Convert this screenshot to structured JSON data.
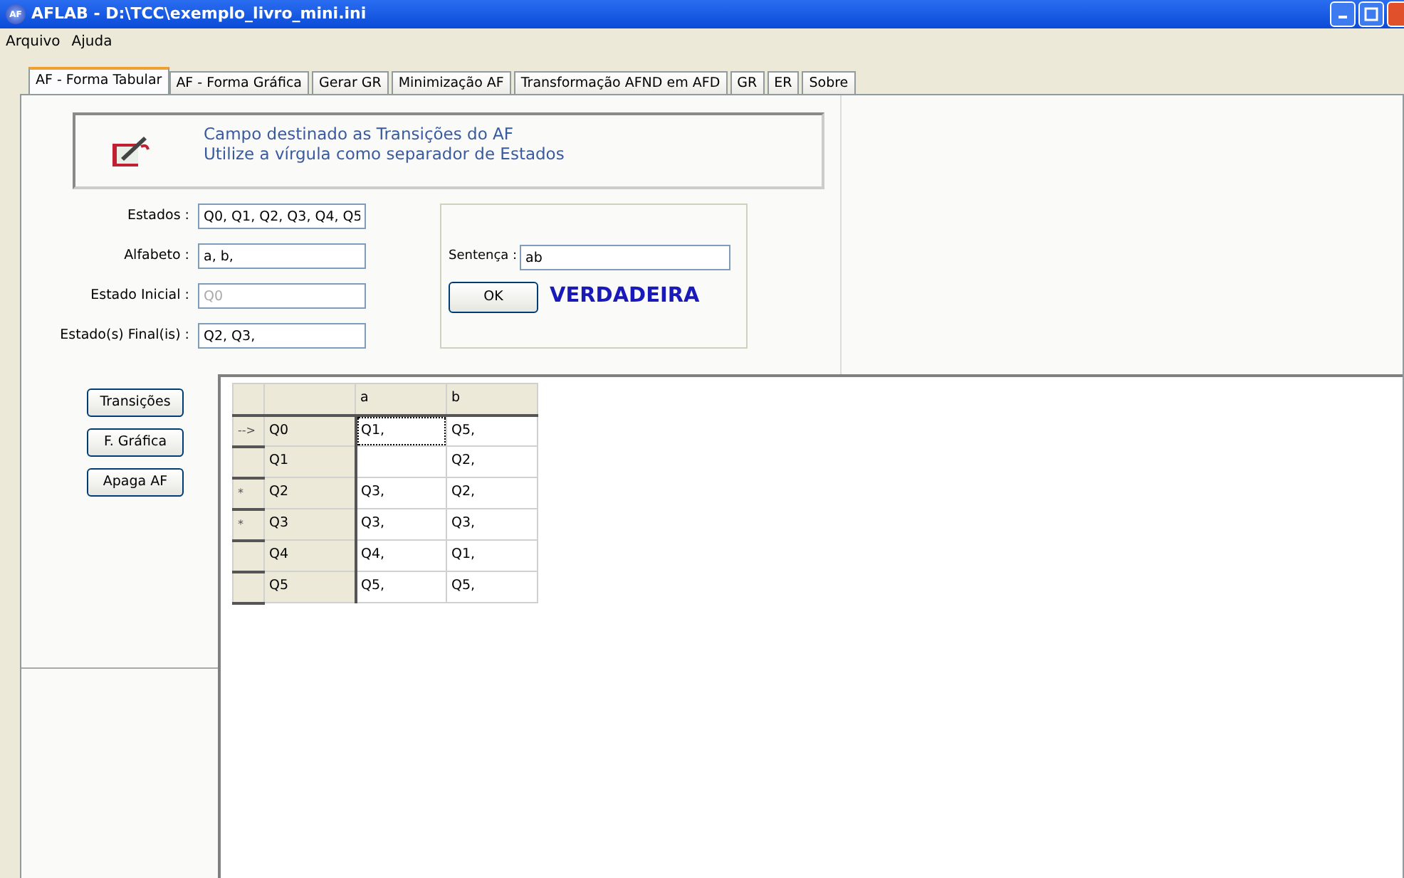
{
  "window": {
    "icon_label": "AF",
    "title": "AFLAB - D:\\TCC\\exemplo_livro_mini.ini"
  },
  "menu": [
    "Arquivo",
    "Ajuda"
  ],
  "tabs": [
    {
      "label": "AF - Forma Tabular",
      "selected": true
    },
    {
      "label": "AF - Forma Gráfica",
      "selected": false
    },
    {
      "label": "Gerar GR",
      "selected": false
    },
    {
      "label": "Minimização AF",
      "selected": false
    },
    {
      "label": "Transformação AFND em AFD",
      "selected": false
    },
    {
      "label": "GR",
      "selected": false
    },
    {
      "label": "ER",
      "selected": false
    },
    {
      "label": "Sobre",
      "selected": false
    }
  ],
  "info": [
    "Campo destinado as Transições do AF",
    "Utilize a vírgula como separador de Estados"
  ],
  "fields": [
    {
      "label": "Estados :",
      "value": "Q0, Q1, Q2, Q3, Q4, Q5",
      "disabled": false
    },
    {
      "label": "Alfabeto :",
      "value": "a, b,",
      "disabled": false
    },
    {
      "label": "Estado Inicial :",
      "value": "Q0",
      "disabled": true
    },
    {
      "label": "Estado(s) Final(is) :",
      "value": "Q2, Q3,",
      "disabled": false
    }
  ],
  "test": {
    "label": "Sentença :",
    "value": "ab",
    "button": "OK",
    "result": "VERDADEIRA"
  },
  "buttons": [
    "Transições",
    "F. Gráfica",
    "Apaga AF"
  ],
  "table": {
    "columns": [
      "a",
      "b"
    ],
    "rows": [
      {
        "marker": "-->",
        "state": "Q0",
        "cells": [
          {
            "text": "Q1,",
            "focused": true
          },
          {
            "text": "Q5,",
            "focused": false
          }
        ]
      },
      {
        "state": "Q1",
        "cells": [
          {
            "focused": false
          },
          {
            "text": "Q2,",
            "focused": false
          }
        ]
      },
      {
        "marker": "*",
        "state": "Q2",
        "cells": [
          {
            "text": "Q3,",
            "focused": false
          },
          {
            "text": "Q2,",
            "focused": false
          }
        ]
      },
      {
        "marker": "*",
        "state": "Q3",
        "cells": [
          {
            "text": "Q3,",
            "focused": false
          },
          {
            "text": "Q3,",
            "focused": false
          }
        ]
      },
      {
        "state": "Q4",
        "cells": [
          {
            "text": "Q4,",
            "focused": false
          },
          {
            "text": "Q1,",
            "focused": false
          }
        ]
      },
      {
        "state": "Q5",
        "cells": [
          {
            "text": "Q5,",
            "focused": false
          },
          {
            "text": "Q5,",
            "focused": false
          }
        ]
      }
    ]
  }
}
